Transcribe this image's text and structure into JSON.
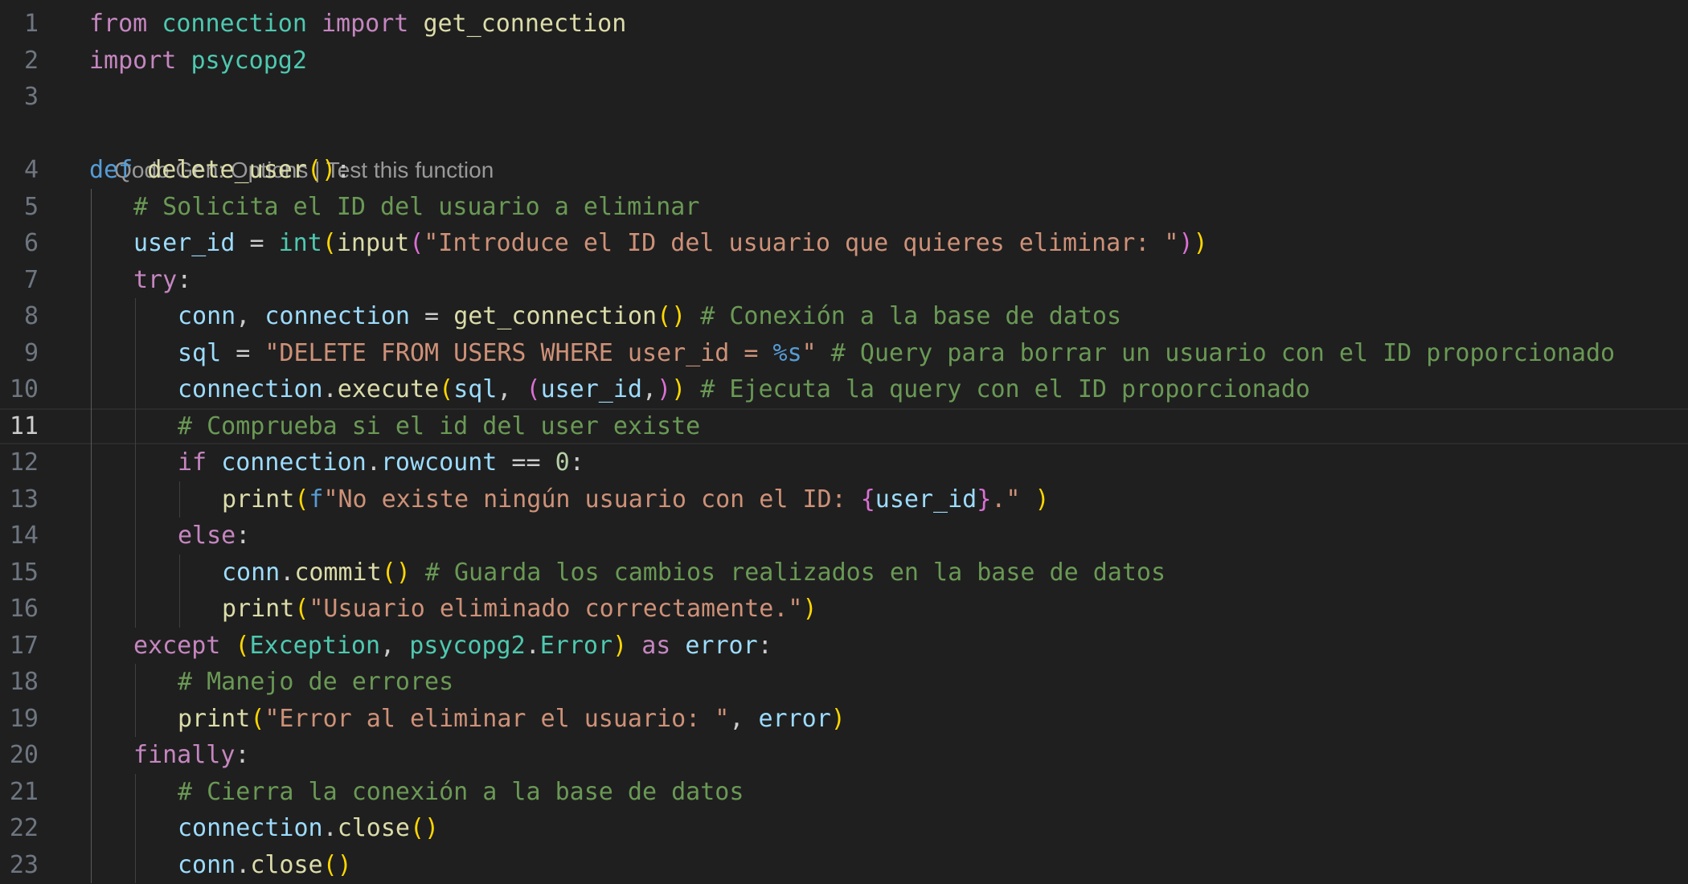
{
  "codelens": {
    "text": "Qodo Gen: Options | Test this function",
    "parts": [
      "Qodo Gen: Options",
      " | ",
      "Test this function"
    ]
  },
  "active_line": 11,
  "lines": [
    {
      "n": "1",
      "indent": 0,
      "tokens": [
        [
          "from",
          "kwc"
        ],
        [
          " ",
          "p"
        ],
        [
          "connection",
          "cls"
        ],
        [
          " ",
          "p"
        ],
        [
          "import",
          "kwc"
        ],
        [
          " ",
          "p"
        ],
        [
          "get_connection",
          "fn"
        ]
      ]
    },
    {
      "n": "2",
      "indent": 0,
      "tokens": [
        [
          "import",
          "kwc"
        ],
        [
          " ",
          "p"
        ],
        [
          "psycopg2",
          "cls"
        ]
      ]
    },
    {
      "n": "3",
      "indent": 0,
      "tokens": []
    },
    {
      "n": "4",
      "indent": 0,
      "tokens": [
        [
          "def",
          "kw"
        ],
        [
          " ",
          "p"
        ],
        [
          "delete_user",
          "fn"
        ],
        [
          "()",
          "b1"
        ],
        [
          ":",
          "p"
        ]
      ]
    },
    {
      "n": "5",
      "indent": 1,
      "tokens": [
        [
          "# Solicita el ID del usuario a eliminar",
          "cmt"
        ]
      ]
    },
    {
      "n": "6",
      "indent": 1,
      "tokens": [
        [
          "user_id",
          "var"
        ],
        [
          " = ",
          "p"
        ],
        [
          "int",
          "cls"
        ],
        [
          "(",
          "b1"
        ],
        [
          "input",
          "fn"
        ],
        [
          "(",
          "b2"
        ],
        [
          "\"Introduce el ID del usuario que quieres eliminar: \"",
          "str"
        ],
        [
          ")",
          "b2"
        ],
        [
          ")",
          "b1"
        ]
      ]
    },
    {
      "n": "7",
      "indent": 1,
      "tokens": [
        [
          "try",
          "kwc"
        ],
        [
          ":",
          "p"
        ]
      ]
    },
    {
      "n": "8",
      "indent": 2,
      "tokens": [
        [
          "conn",
          "var"
        ],
        [
          ", ",
          "p"
        ],
        [
          "connection",
          "var"
        ],
        [
          " = ",
          "p"
        ],
        [
          "get_connection",
          "fn"
        ],
        [
          "()",
          "b1"
        ],
        [
          " ",
          "p"
        ],
        [
          "# Conexión a la base de datos",
          "cmt"
        ]
      ]
    },
    {
      "n": "9",
      "indent": 2,
      "tokens": [
        [
          "sql",
          "var"
        ],
        [
          " = ",
          "p"
        ],
        [
          "\"DELETE FROM USERS WHERE user_id = ",
          "str"
        ],
        [
          "%s",
          "fmt"
        ],
        [
          "\"",
          "str"
        ],
        [
          " ",
          "p"
        ],
        [
          "# Query para borrar un usuario con el ID proporcionado",
          "cmt"
        ]
      ]
    },
    {
      "n": "10",
      "indent": 2,
      "tokens": [
        [
          "connection",
          "var"
        ],
        [
          ".",
          "p"
        ],
        [
          "execute",
          "fn"
        ],
        [
          "(",
          "b1"
        ],
        [
          "sql",
          "var"
        ],
        [
          ", ",
          "p"
        ],
        [
          "(",
          "b2"
        ],
        [
          "user_id",
          "var"
        ],
        [
          ",",
          "p"
        ],
        [
          ")",
          "b2"
        ],
        [
          ")",
          "b1"
        ],
        [
          " ",
          "p"
        ],
        [
          "# Ejecuta la query con el ID proporcionado",
          "cmt"
        ]
      ]
    },
    {
      "n": "11",
      "indent": 2,
      "tokens": [
        [
          "# Comprueba si el id del user existe",
          "cmt"
        ]
      ]
    },
    {
      "n": "12",
      "indent": 2,
      "tokens": [
        [
          "if",
          "kwc"
        ],
        [
          " ",
          "p"
        ],
        [
          "connection",
          "var"
        ],
        [
          ".",
          "p"
        ],
        [
          "rowcount",
          "var"
        ],
        [
          " == ",
          "p"
        ],
        [
          "0",
          "num"
        ],
        [
          ":",
          "p"
        ]
      ]
    },
    {
      "n": "13",
      "indent": 3,
      "tokens": [
        [
          "print",
          "fn"
        ],
        [
          "(",
          "b1"
        ],
        [
          "f",
          "fmt"
        ],
        [
          "\"No existe ningún usuario con el ID: ",
          "str"
        ],
        [
          "{",
          "b2"
        ],
        [
          "user_id",
          "var"
        ],
        [
          "}",
          "b2"
        ],
        [
          ".\"",
          "str"
        ],
        [
          " ",
          "p"
        ],
        [
          ")",
          "b1"
        ]
      ]
    },
    {
      "n": "14",
      "indent": 2,
      "tokens": [
        [
          "else",
          "kwc"
        ],
        [
          ":",
          "p"
        ]
      ]
    },
    {
      "n": "15",
      "indent": 3,
      "tokens": [
        [
          "conn",
          "var"
        ],
        [
          ".",
          "p"
        ],
        [
          "commit",
          "fn"
        ],
        [
          "()",
          "b1"
        ],
        [
          " ",
          "p"
        ],
        [
          "# Guarda los cambios realizados en la base de datos",
          "cmt"
        ]
      ]
    },
    {
      "n": "16",
      "indent": 3,
      "tokens": [
        [
          "print",
          "fn"
        ],
        [
          "(",
          "b1"
        ],
        [
          "\"Usuario eliminado correctamente.\"",
          "str"
        ],
        [
          ")",
          "b1"
        ]
      ]
    },
    {
      "n": "17",
      "indent": 1,
      "tokens": [
        [
          "except",
          "kwc"
        ],
        [
          " ",
          "p"
        ],
        [
          "(",
          "b1"
        ],
        [
          "Exception",
          "cls"
        ],
        [
          ", ",
          "p"
        ],
        [
          "psycopg2",
          "cls"
        ],
        [
          ".",
          "p"
        ],
        [
          "Error",
          "cls"
        ],
        [
          ")",
          "b1"
        ],
        [
          " ",
          "p"
        ],
        [
          "as",
          "kwc"
        ],
        [
          " ",
          "p"
        ],
        [
          "error",
          "var"
        ],
        [
          ":",
          "p"
        ]
      ]
    },
    {
      "n": "18",
      "indent": 2,
      "tokens": [
        [
          "# Manejo de errores",
          "cmt"
        ]
      ]
    },
    {
      "n": "19",
      "indent": 2,
      "tokens": [
        [
          "print",
          "fn"
        ],
        [
          "(",
          "b1"
        ],
        [
          "\"Error al eliminar el usuario: \"",
          "str"
        ],
        [
          ", ",
          "p"
        ],
        [
          "error",
          "var"
        ],
        [
          ")",
          "b1"
        ]
      ]
    },
    {
      "n": "20",
      "indent": 1,
      "tokens": [
        [
          "finally",
          "kwc"
        ],
        [
          ":",
          "p"
        ]
      ]
    },
    {
      "n": "21",
      "indent": 2,
      "tokens": [
        [
          "# Cierra la conexión a la base de datos",
          "cmt"
        ]
      ]
    },
    {
      "n": "22",
      "indent": 2,
      "tokens": [
        [
          "connection",
          "var"
        ],
        [
          ".",
          "p"
        ],
        [
          "close",
          "fn"
        ],
        [
          "()",
          "b1"
        ]
      ]
    },
    {
      "n": "23",
      "indent": 2,
      "tokens": [
        [
          "conn",
          "var"
        ],
        [
          ".",
          "p"
        ],
        [
          "close",
          "fn"
        ],
        [
          "()",
          "b1"
        ]
      ]
    }
  ],
  "guides": [
    {
      "level": 1,
      "from_line": "5",
      "to_line": "23"
    },
    {
      "level": 2,
      "from_line": "8",
      "to_line": "16"
    },
    {
      "level": 3,
      "from_line": "13",
      "to_line": "13"
    },
    {
      "level": 3,
      "from_line": "15",
      "to_line": "16"
    },
    {
      "level": 2,
      "from_line": "18",
      "to_line": "19"
    },
    {
      "level": 2,
      "from_line": "21",
      "to_line": "23"
    }
  ],
  "colors": {
    "background": "#1f1f1f",
    "control_keyword": "#c586c0",
    "keyword": "#569cd6",
    "function": "#dcdcaa",
    "class_module": "#4ec9b0",
    "variable": "#9cdcfe",
    "string": "#ce9178",
    "comment": "#6a9955",
    "number": "#b5cea8",
    "bracket_1": "#ffd700",
    "bracket_2": "#da70d6"
  }
}
